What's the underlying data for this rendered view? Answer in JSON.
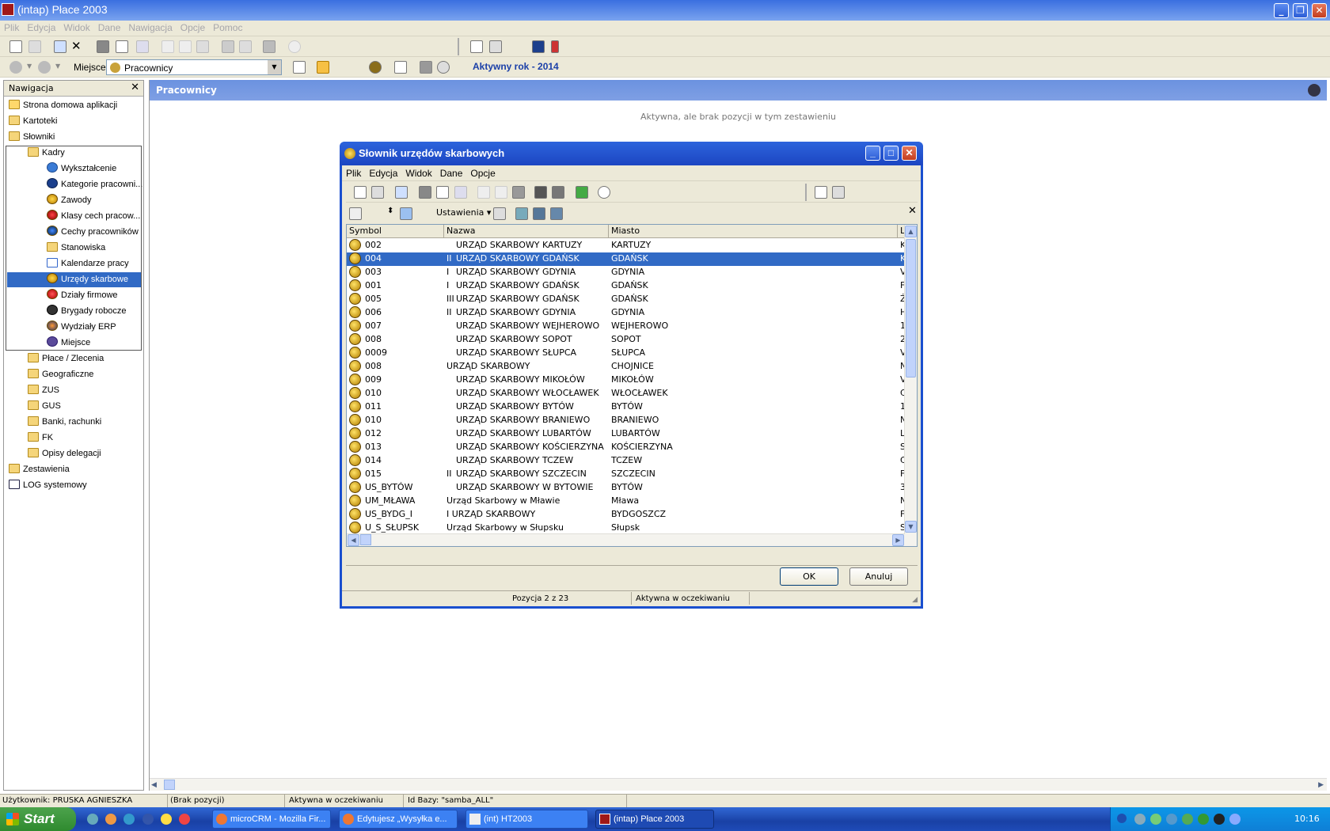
{
  "app": {
    "title": "(intap)  Płace 2003"
  },
  "menu": [
    "Plik",
    "Edycja",
    "Widok",
    "Dane",
    "Nawigacja",
    "Opcje",
    "Pomoc"
  ],
  "toolbar2": {
    "place_label": "Miejsce",
    "place_value": "Pracownicy",
    "active_year": "Aktywny rok - 2014"
  },
  "nav": {
    "title": "Nawigacja",
    "close": "✕",
    "items": [
      "Strona domowa aplikacji",
      "Kartoteki",
      "Słowniki",
      "Kadry",
      "Wykształcenie",
      "Kategorie pracowni...",
      "Zawody",
      "Klasy cech pracow...",
      "Cechy pracowników",
      "Stanowiska",
      "Kalendarze pracy",
      "Urzędy skarbowe",
      "Działy firmowe",
      "Brygady robocze",
      "Wydziały ERP",
      "Miejsce",
      "Płace / Zlecenia",
      "Geograficzne",
      "ZUS",
      "GUS",
      "Banki, rachunki",
      "FK",
      "Opisy delegacji",
      "Zestawienia",
      "LOG systemowy"
    ]
  },
  "content": {
    "title": "Pracownicy",
    "empty_msg": "Aktywna, ale brak pozycji w tym zestawieniu"
  },
  "dialog": {
    "title": "Słownik urzędów skarbowych",
    "menu": [
      "Plik",
      "Edycja",
      "Widok",
      "Dane",
      "Opcje"
    ],
    "settings_label": "Ustawienia",
    "columns": [
      "Symbol",
      "Nazwa",
      "Miasto",
      "L"
    ],
    "rows": [
      {
        "symbol": "002",
        "prefix": "",
        "name": "URZĄD SKARBOWY KARTUZY",
        "city": "KARTUZY",
        "l": "K"
      },
      {
        "symbol": "004",
        "prefix": "II",
        "name": "URZĄD SKARBOWY GDAŃSK",
        "city": "GDAŃSK",
        "l": "K"
      },
      {
        "symbol": "003",
        "prefix": "I",
        "name": "URZĄD SKARBOWY GDYNIA",
        "city": "GDYNIA",
        "l": "V"
      },
      {
        "symbol": "001",
        "prefix": "I",
        "name": "URZĄD SKARBOWY GDAŃSK",
        "city": "GDAŃSK",
        "l": "F"
      },
      {
        "symbol": "005",
        "prefix": "III",
        "name": "URZĄD SKARBOWY GDAŃSK",
        "city": "GDAŃSK",
        "l": "Ż"
      },
      {
        "symbol": "006",
        "prefix": "II",
        "name": "URZĄD SKARBOWY GDYNIA",
        "city": "GDYNIA",
        "l": "H"
      },
      {
        "symbol": "007",
        "prefix": "",
        "name": "URZĄD SKARBOWY WEJHEROWO",
        "city": "WEJHEROWO",
        "l": "1"
      },
      {
        "symbol": "008",
        "prefix": "",
        "name": "URZĄD SKARBOWY SOPOT",
        "city": "SOPOT",
        "l": "2"
      },
      {
        "symbol": "0009",
        "prefix": "",
        "name": "URZĄD SKARBOWY SŁUPCA",
        "city": "SŁUPCA",
        "l": "V"
      },
      {
        "symbol": "008",
        "prefix": "",
        "name": "URZĄD SKARBOWY",
        "city": "CHOJNICE",
        "l": "N"
      },
      {
        "symbol": "009",
        "prefix": "",
        "name": "URZĄD SKARBOWY MIKOŁÓW",
        "city": "MIKOŁÓW",
        "l": "V"
      },
      {
        "symbol": "010",
        "prefix": "",
        "name": "URZĄD SKARBOWY WŁOCŁAWEK",
        "city": "WŁOCŁAWEK",
        "l": "C"
      },
      {
        "symbol": "011",
        "prefix": "",
        "name": "URZĄD SKARBOWY BYTÓW",
        "city": "BYTÓW",
        "l": "1"
      },
      {
        "symbol": "010",
        "prefix": "",
        "name": "URZĄD SKARBOWY BRANIEWO",
        "city": "BRANIEWO",
        "l": "N"
      },
      {
        "symbol": "012",
        "prefix": "",
        "name": "URZĄD SKARBOWY LUBARTÓW",
        "city": "LUBARTÓW",
        "l": "L"
      },
      {
        "symbol": "013",
        "prefix": "",
        "name": "URZĄD SKARBOWY KOŚCIERZYNA",
        "city": "KOŚCIERZYNA",
        "l": "S"
      },
      {
        "symbol": "014",
        "prefix": "",
        "name": "URZĄD SKARBOWY TCZEW",
        "city": "TCZEW",
        "l": "C"
      },
      {
        "symbol": "015",
        "prefix": "II",
        "name": "URZĄD SKARBOWY SZCZECIN",
        "city": "SZCZECIN",
        "l": "F"
      },
      {
        "symbol": "US_BYTÓW",
        "prefix": "",
        "name": "URZĄD SKARBOWY W BYTOWIE",
        "city": "BYTÓW",
        "l": "3"
      },
      {
        "symbol": "UM_MŁAWA",
        "prefix": "",
        "name": "Urząd Skarbowy w Mławie",
        "city": "Mława",
        "l": "N"
      },
      {
        "symbol": "US_BYDG_I",
        "prefix": "",
        "name": "I URZĄD SKARBOWY",
        "city": "BYDGOSZCZ",
        "l": "F"
      },
      {
        "symbol": "U_S_SŁUPSK",
        "prefix": "",
        "name": "Urząd Skarbowy w Słupsku",
        "city": "Słupsk",
        "l": "S"
      }
    ],
    "ok": "OK",
    "cancel": "Anuluj",
    "status_pos": "Pozycja 2 z 23",
    "status_state": "Aktywna w oczekiwaniu"
  },
  "status": {
    "user": "Użytkownik: PRUSKA AGNIESZKA",
    "items": "(Brak pozycji)",
    "state": "Aktywna w oczekiwaniu",
    "db": "Id Bazy: \"samba_ALL\""
  },
  "taskbar": {
    "start": "Start",
    "tasks": [
      "microCRM - Mozilla Fir...",
      "Edytujesz „Wysyłka e...",
      "(int)  HT2003",
      "(intap)  Płace 2003"
    ],
    "clock": "10:16"
  }
}
